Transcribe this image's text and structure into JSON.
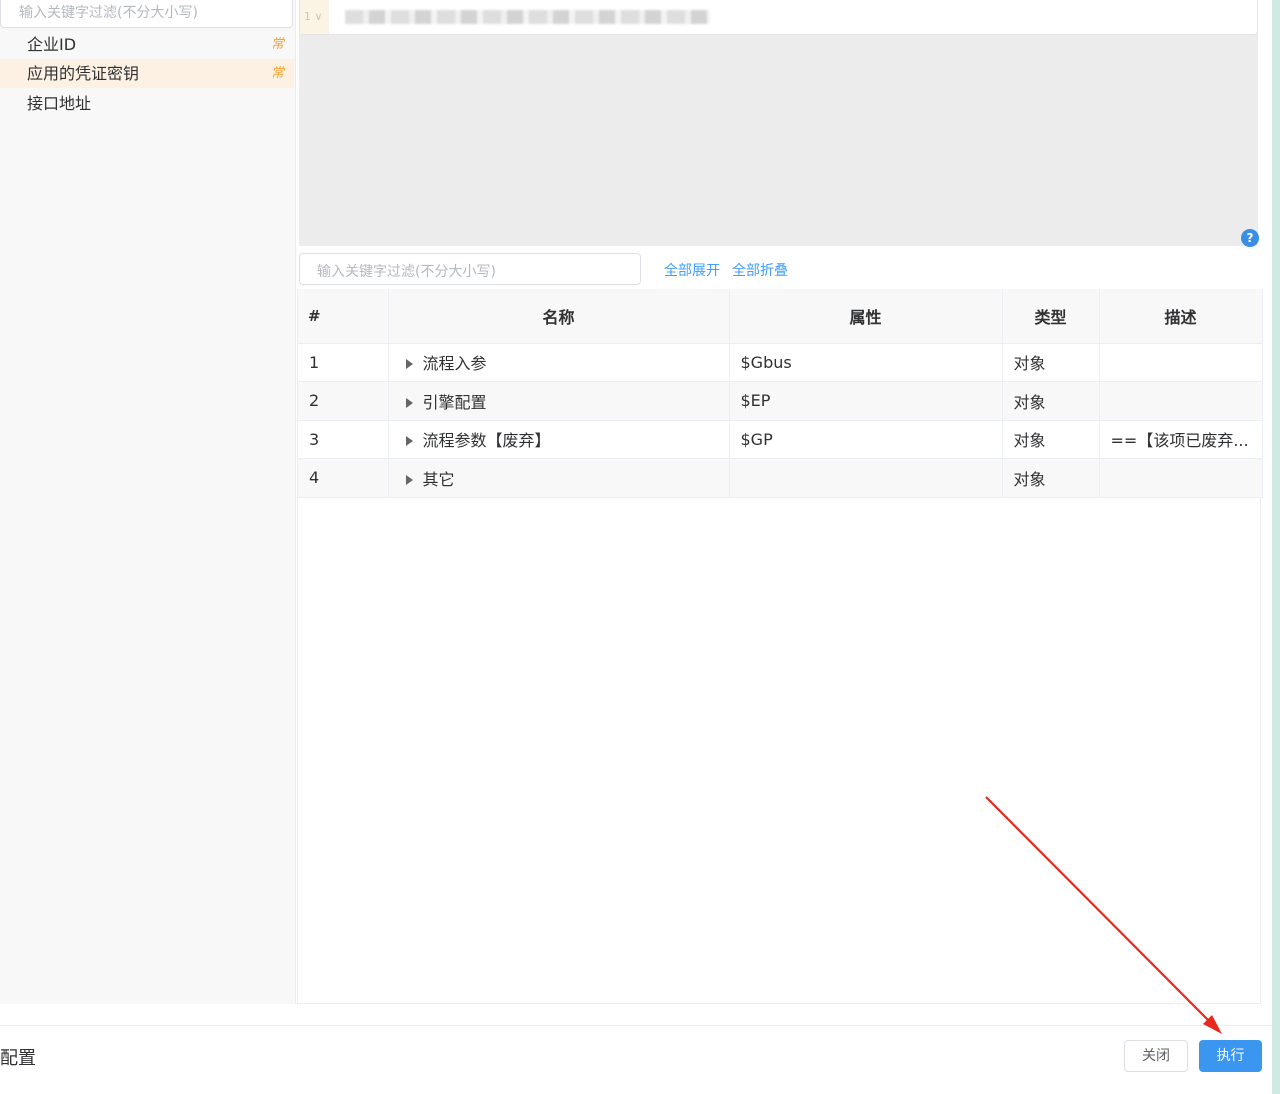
{
  "sidebar": {
    "search_placeholder": "输入关键字过滤(不分大小写)",
    "items": [
      {
        "label": "企业ID",
        "badge": "常"
      },
      {
        "label": "应用的凭证密钥",
        "badge": "常"
      },
      {
        "label": "接口地址",
        "badge": ""
      }
    ]
  },
  "editor": {
    "line_number": "1"
  },
  "table_filter": {
    "placeholder": "输入关键字过滤(不分大小写)",
    "expand_all": "全部展开",
    "collapse_all": "全部折叠"
  },
  "table": {
    "headers": {
      "num": "#",
      "name": "名称",
      "attr": "属性",
      "type": "类型",
      "desc": "描述"
    },
    "rows": [
      {
        "num": "1",
        "name": "流程入参",
        "attr": "$Gbus",
        "type": "对象",
        "desc": ""
      },
      {
        "num": "2",
        "name": "引擎配置",
        "attr": "$EP",
        "type": "对象",
        "desc": ""
      },
      {
        "num": "3",
        "name": "流程参数【废弃】",
        "attr": "$GP",
        "type": "对象",
        "desc": "==【该项已废弃..."
      },
      {
        "num": "4",
        "name": "其它",
        "attr": "",
        "type": "对象",
        "desc": ""
      }
    ]
  },
  "footer": {
    "title": "配置",
    "close_label": "关闭",
    "run_label": "执行"
  },
  "colors": {
    "accent": "#409eff",
    "primary_button": "#3b96ef",
    "badge": "#f0a030",
    "annotation_arrow": "#e8281e"
  },
  "icons": {
    "help": "question-circle-icon",
    "row_expand": "caret-right-icon"
  }
}
